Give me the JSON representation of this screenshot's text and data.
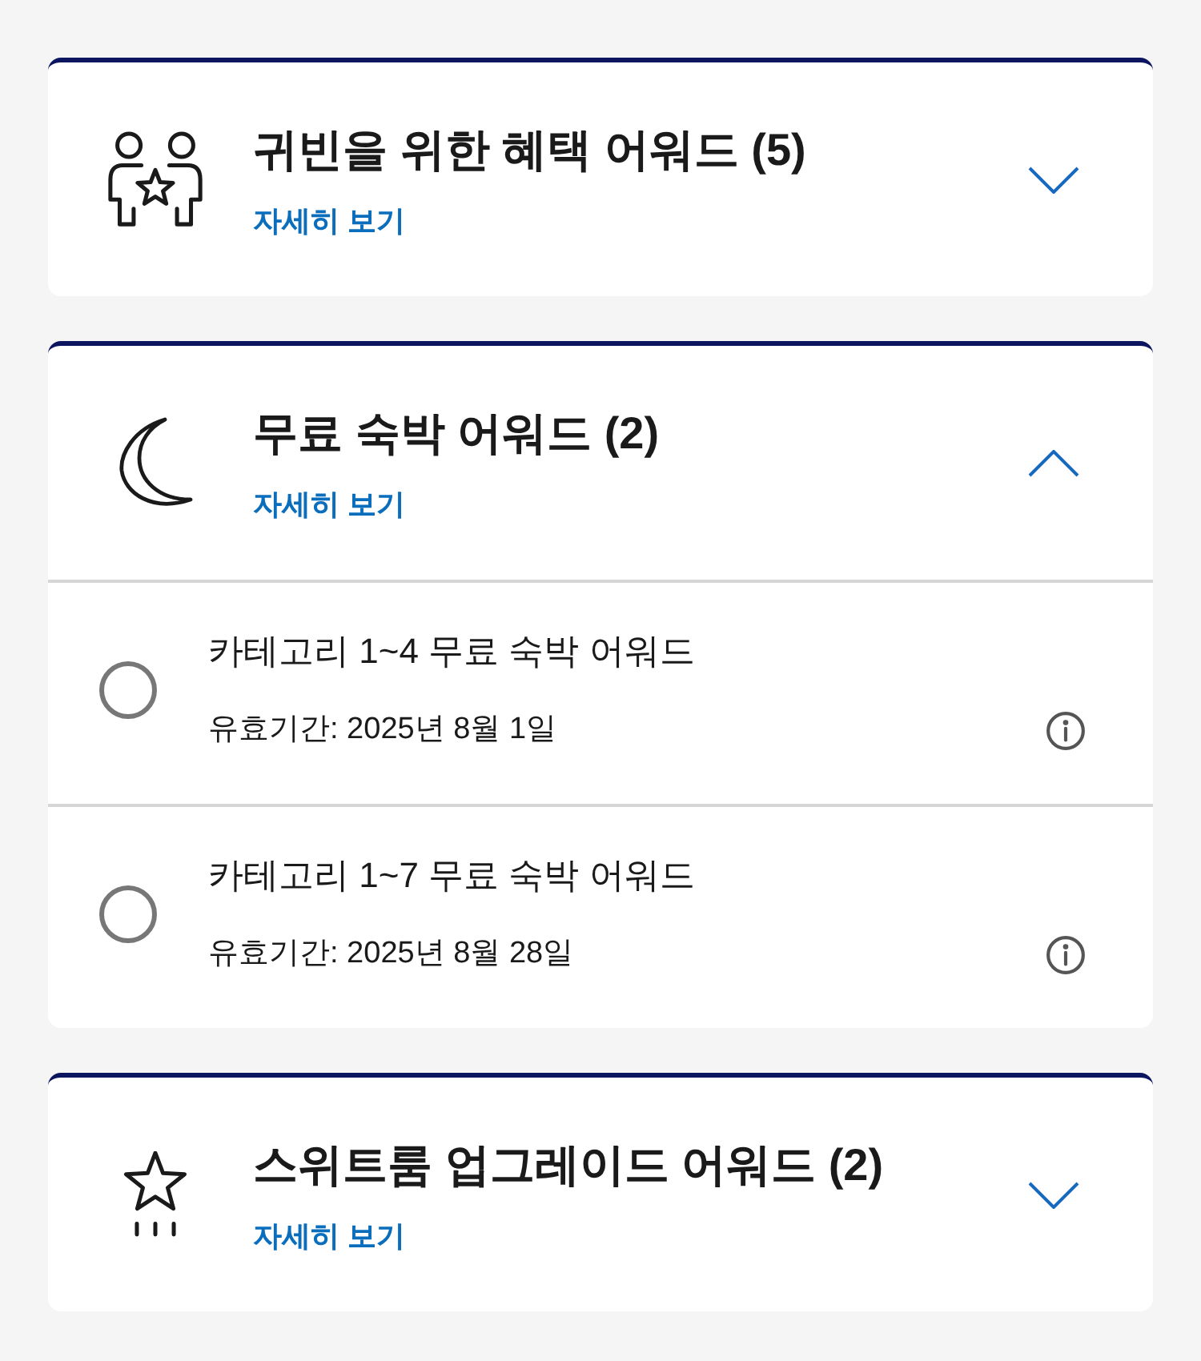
{
  "sections": [
    {
      "kind": "guests",
      "title": "귀빈을 위한 혜택 어워드 (5)",
      "link": "자세히 보기",
      "expanded": false
    },
    {
      "kind": "moon",
      "title": "무료 숙박 어워드 (2)",
      "link": "자세히 보기",
      "expanded": true,
      "awards": [
        {
          "name": "카테고리 1~4 무료 숙박 어워드",
          "validity": "유효기간: 2025년 8월 1일",
          "selected": false
        },
        {
          "name": "카테고리 1~7 무료 숙박 어워드",
          "validity": "유효기간: 2025년 8월 28일",
          "selected": false
        }
      ]
    },
    {
      "kind": "star",
      "title": "스위트룸 업그레이드 어워드 (2)",
      "link": "자세히 보기",
      "expanded": false
    }
  ]
}
